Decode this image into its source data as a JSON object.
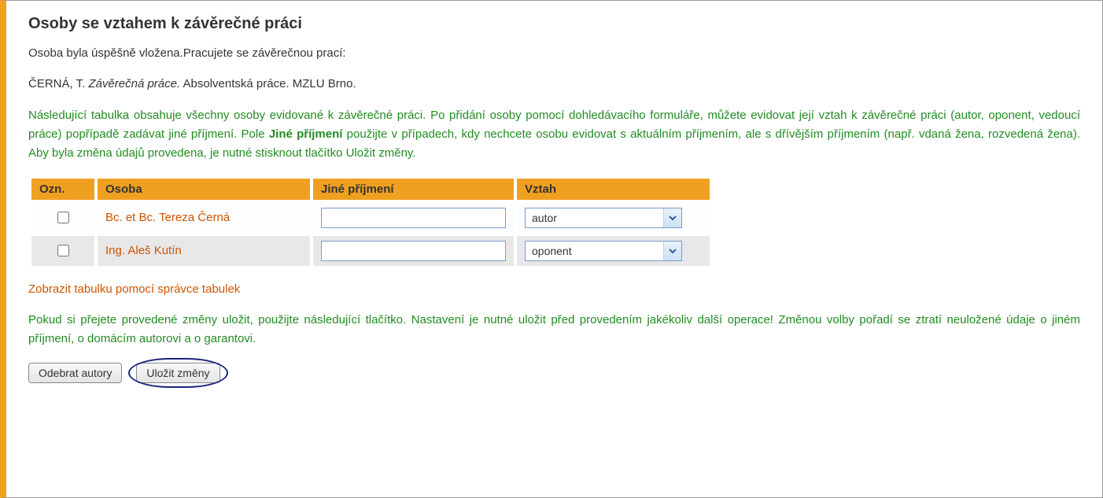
{
  "title": "Osoby se vztahem k závěrečné práci",
  "status_text": "Osoba byla úspěšně vložena.Pracujete se závěrečnou prací:",
  "citation": {
    "author": "ČERNÁ, T.",
    "title_italic": "Závěrečná práce.",
    "rest": "Absolventská práce. MZLU Brno."
  },
  "green_para_1_a": "Následující tabulka obsahuje všechny osoby evidované k závěrečné práci. Po přidání osoby pomocí dohledávacího formuláře, můžete evidovat její vztah k závěrečné práci (autor, oponent, vedoucí práce) popřípadě zadávat jiné příjmení. Pole ",
  "green_para_1_bold": "Jiné příjmení",
  "green_para_1_b": " použijte v případech, kdy nechcete osobu evidovat s aktuálním příjmením, ale s dřívějším příjmením (např. vdaná žena, rozvedená žena). Aby byla změna údajů provedena, je nutné stisknout tlačítko Uložit změny.",
  "table": {
    "headers": {
      "ozn": "Ozn.",
      "osoba": "Osoba",
      "jine": "Jiné příjmení",
      "vztah": "Vztah"
    },
    "rows": [
      {
        "name": "Bc. et Bc. Tereza Černá",
        "surname": "",
        "relation": "autor"
      },
      {
        "name": "Ing. Aleš Kutín",
        "surname": "",
        "relation": "oponent"
      }
    ]
  },
  "table_manager_link": "Zobrazit tabulku pomocí správce tabulek",
  "green_para_2": "Pokud si přejete provedené změny uložit, použijte následující tlačítko. Nastavení je nutné uložit před provedením jakékoliv další operace! Změnou volby pořadí se ztratí neuložené údaje o jiném příjmení, o domácím autorovi a o garantovi.",
  "buttons": {
    "remove": "Odebrat autory",
    "save": "Uložit změny"
  }
}
